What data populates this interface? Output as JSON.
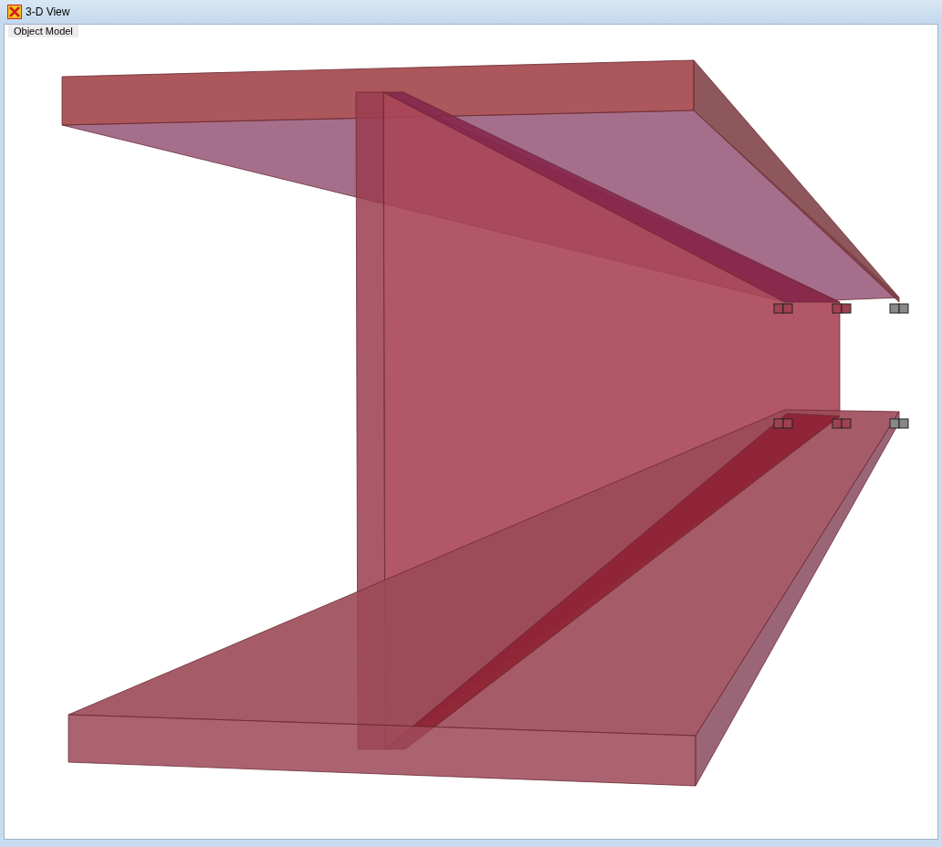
{
  "window": {
    "title": "3-D View"
  },
  "tabs": [
    {
      "label": "Object Model",
      "selected": true
    }
  ]
}
